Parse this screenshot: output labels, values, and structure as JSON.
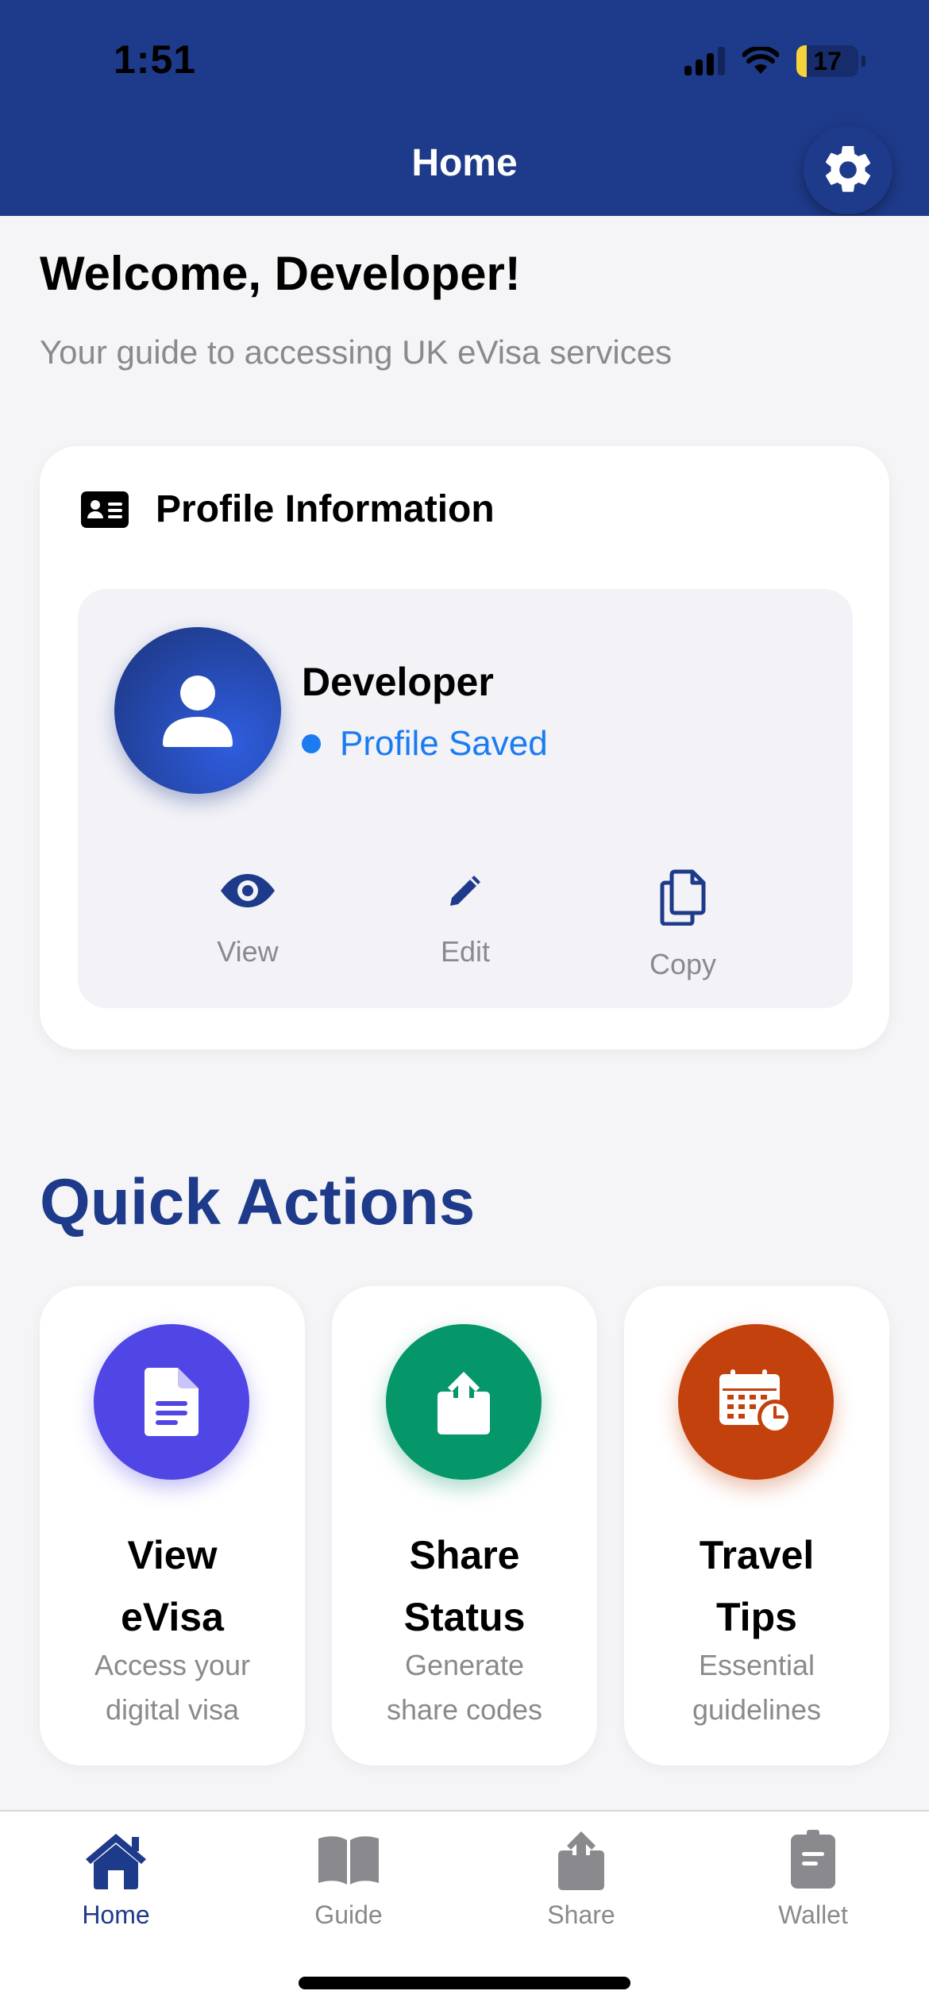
{
  "status_bar": {
    "time": "1:51",
    "battery_level": "17",
    "battery_fraction": 0.17
  },
  "header": {
    "title": "Home",
    "settings_icon": "gear-icon",
    "background_color": "#1e3a8a"
  },
  "welcome": {
    "title": "Welcome, Developer!",
    "subtitle": "Your guide to accessing UK eVisa services"
  },
  "profile_card": {
    "title": "Profile Information",
    "title_icon": "id-card-icon",
    "name": "Developer",
    "status": "Profile Saved",
    "status_color": "#1a7cf0",
    "actions": [
      {
        "label": "View",
        "icon": "eye-icon"
      },
      {
        "label": "Edit",
        "icon": "pencil-icon"
      },
      {
        "label": "Copy",
        "icon": "copy-icon"
      }
    ]
  },
  "quick_actions": {
    "title": "Quick Actions",
    "items": [
      {
        "label_line1": "View",
        "label_line2": "eVisa",
        "desc_line1": "Access your",
        "desc_line2": "digital visa",
        "icon": "document-icon",
        "color": "#5046e5"
      },
      {
        "label_line1": "Share",
        "label_line2": "Status",
        "desc_line1": "Generate",
        "desc_line2": "share codes",
        "icon": "share-icon",
        "color": "#059669"
      },
      {
        "label_line1": "Travel",
        "label_line2": "Tips",
        "desc_line1": "Essential",
        "desc_line2": "guidelines",
        "icon": "calendar-clock-icon",
        "color": "#c2410c"
      }
    ]
  },
  "tab_bar": {
    "active": "Home",
    "tabs": [
      {
        "label": "Home",
        "icon": "house-icon"
      },
      {
        "label": "Guide",
        "icon": "book-icon"
      },
      {
        "label": "Share",
        "icon": "share-icon"
      },
      {
        "label": "Wallet",
        "icon": "wallet-icon"
      }
    ]
  }
}
